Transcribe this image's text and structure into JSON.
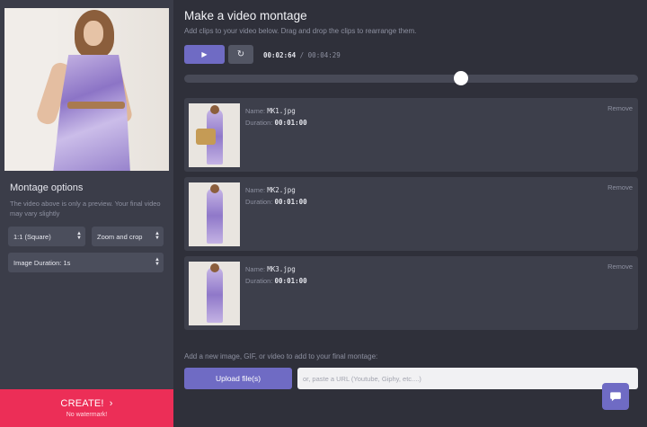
{
  "sidebar": {
    "options_title": "Montage options",
    "options_note": "The video above is only a preview. Your final video may vary slightly",
    "aspect_select": "1:1 (Square)",
    "zoom_select": "Zoom and crop",
    "duration_select": "Image Duration: 1s",
    "create_label": "CREATE!",
    "create_sub": "No watermark!"
  },
  "main": {
    "title": "Make a video montage",
    "subtitle": "Add clips to your video below. Drag and drop the clips to rearrange them.",
    "player": {
      "current_time": "00:02:64",
      "separator": "/",
      "total_time": "00:04:29",
      "progress": 0.61
    },
    "clips": [
      {
        "name_label": "Name:",
        "name": "MK1.jpg",
        "duration_label": "Duration:",
        "duration": "00:01:00",
        "remove": "Remove"
      },
      {
        "name_label": "Name:",
        "name": "MK2.jpg",
        "duration_label": "Duration:",
        "duration": "00:01:00",
        "remove": "Remove"
      },
      {
        "name_label": "Name:",
        "name": "MK3.jpg",
        "duration_label": "Duration:",
        "duration": "00:01:00",
        "remove": "Remove"
      }
    ],
    "add_label": "Add a new image, GIF, or video to add to your final montage:",
    "upload_label": "Upload file(s)",
    "url_placeholder": "or, paste a URL (Youtube, Giphy, etc....)"
  },
  "icons": {
    "play": "play-icon",
    "reset": "reset-icon",
    "chat": "chat-icon",
    "chevron": "chevron-right-icon"
  },
  "colors": {
    "accent": "#6f6bc4",
    "create": "#ec2e57",
    "background": "#2f303a",
    "sidebar": "#3b3d49"
  }
}
